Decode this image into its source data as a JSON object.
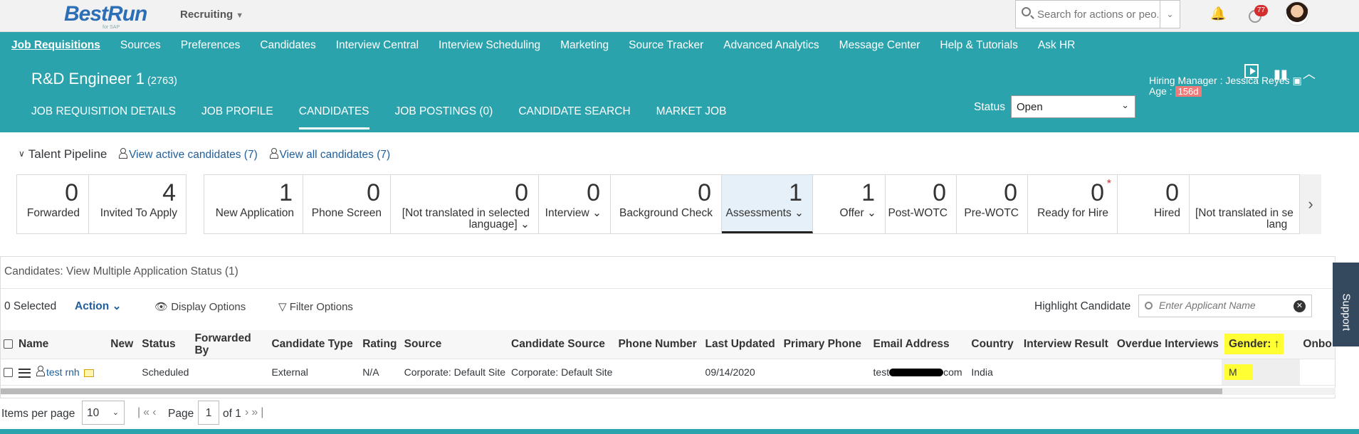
{
  "shell": {
    "logo_text": "BestRun",
    "logo_sub": "for SAP",
    "module": "Recruiting",
    "search_placeholder": "Search for actions or peo...",
    "notifications_count": "77"
  },
  "nav": {
    "items": [
      "Job Requisitions",
      "Sources",
      "Preferences",
      "Candidates",
      "Interview Central",
      "Interview Scheduling",
      "Marketing",
      "Source Tracker",
      "Advanced Analytics",
      "Message Center",
      "Help & Tutorials",
      "Ask HR"
    ]
  },
  "header": {
    "title": "R&D Engineer 1",
    "req_id": "(2763)",
    "tabs": [
      "JOB REQUISITION DETAILS",
      "JOB PROFILE",
      "CANDIDATES",
      "JOB POSTINGS (0)",
      "CANDIDATE SEARCH",
      "MARKET JOB"
    ],
    "status_label": "Status",
    "status_value": "Open",
    "hiring_manager": "Hiring Manager : Jessica Reyes",
    "age_label": "Age :",
    "age_value": "156d"
  },
  "pipeline": {
    "title": "Talent Pipeline",
    "view_active": "View active candidates (7)",
    "view_all": "View all candidates (7)",
    "group1": [
      {
        "count": "0",
        "label": "Forwarded"
      },
      {
        "count": "4",
        "label": "Invited To Apply"
      }
    ],
    "group2": [
      {
        "count": "1",
        "label": "New Application"
      },
      {
        "count": "0",
        "label": "Phone Screen"
      },
      {
        "count": "0",
        "label": "[Not translated in selected",
        "label2": "language] ⌄"
      },
      {
        "count": "0",
        "label": "Interview ⌄"
      },
      {
        "count": "0",
        "label": "Background Check"
      },
      {
        "count": "1",
        "label": "Assessments ⌄"
      },
      {
        "count": "1",
        "label": "Offer ⌄"
      },
      {
        "count": "0",
        "label": "Post-WOTC"
      },
      {
        "count": "0",
        "label": "Pre-WOTC"
      },
      {
        "count": "0",
        "label": "Ready for Hire"
      },
      {
        "count": "0",
        "label": "Hired"
      },
      {
        "count": "",
        "label": "[Not translated in se",
        "label2": "lang"
      }
    ]
  },
  "candidates": {
    "title": "Candidates: View Multiple Application Status (1)",
    "selected": "0 Selected",
    "action": "Action",
    "display_options": "Display Options",
    "filter_options": "Filter Options",
    "highlight_label": "Highlight Candidate",
    "highlight_placeholder": "Enter Applicant Name",
    "columns": [
      "Name",
      "New",
      "Status",
      "Forwarded By",
      "Candidate Type",
      "Rating",
      "Source",
      "Candidate Source",
      "Phone Number",
      "Last Updated",
      "Primary Phone",
      "Email Address",
      "Country",
      "Interview Result",
      "Overdue Interviews",
      "Gender: ↑",
      "Onbo"
    ],
    "rows": [
      {
        "name": "test rnh",
        "new": "",
        "status": "Scheduled",
        "forwarded_by": "",
        "type": "External",
        "rating": "N/A",
        "source": "Corporate: Default Site",
        "candidate_source": "Corporate: Default Site",
        "phone": "",
        "last_updated": "09/14/2020",
        "primary_phone": "",
        "email_pre": "test",
        "email_post": "com",
        "country": "India",
        "interview_result": "",
        "overdue": "",
        "gender": "M",
        "onbo": ""
      }
    ]
  },
  "pager": {
    "items_per_page_label": "Items per page",
    "items_per_page": "10",
    "page_label": "Page",
    "page": "1",
    "of": "of 1"
  },
  "support": "Support"
}
